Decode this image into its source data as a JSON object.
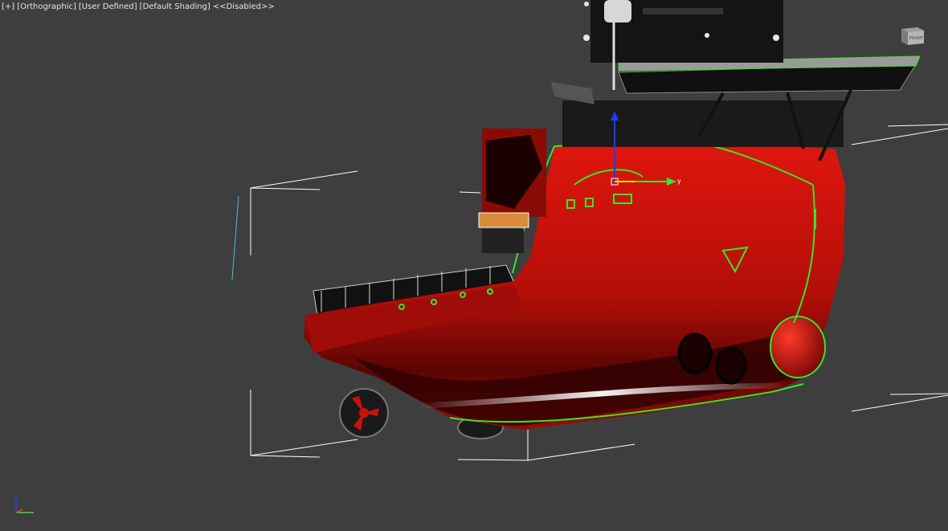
{
  "viewport": {
    "labels": {
      "plus": "[+]",
      "view": "[Orthographic]",
      "camera": "[User Defined]",
      "shading": "[Default Shading]",
      "disabled": "<<Disabled>>"
    },
    "gizmo_axis_label": "y",
    "viewcube_label": "FRONT"
  },
  "colors": {
    "background": "#3e3e3e",
    "hull_red": "#c8120c",
    "selection_green": "#33e82a",
    "bbox_white": "#ffffff"
  }
}
